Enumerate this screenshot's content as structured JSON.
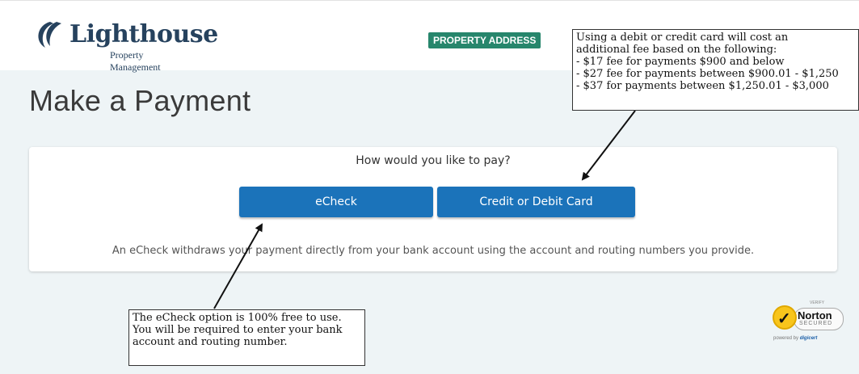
{
  "header": {
    "logo_name": "Lighthouse",
    "logo_sub": "Property Management",
    "property_badge": "PROPERTY ADDRESS"
  },
  "page_title": "Make a Payment",
  "payment": {
    "question": "How would you like to pay?",
    "echeck_label": "eCheck",
    "card_label": "Credit or Debit Card",
    "description": "An eCheck withdraws your payment directly from your bank account using the account and routing numbers you provide."
  },
  "annotations": {
    "card_note": [
      "Using a debit or credit card will cost an",
      "additional fee based on the following:",
      "- $17 fee for payments $900 and below",
      "- $27 fee for payments between $900.01 - $1,250",
      "- $37 for payments between $1,250.01 - $3,000"
    ],
    "echeck_note": [
      "The eCheck option is 100% free to use.",
      "You will be required to enter your bank",
      "account and routing number."
    ]
  },
  "seal": {
    "verify": "VERIFY",
    "name": "Norton",
    "secured": "SECURED",
    "powered_by": "powered by",
    "digicert": "digicert"
  },
  "colors": {
    "brand_navy": "#26425e",
    "badge_green": "#27866c",
    "button_blue": "#1b73ba",
    "page_bg": "#eef4f6"
  },
  "icons": [
    "lighthouse-swoosh-logo",
    "norton-check-seal"
  ]
}
